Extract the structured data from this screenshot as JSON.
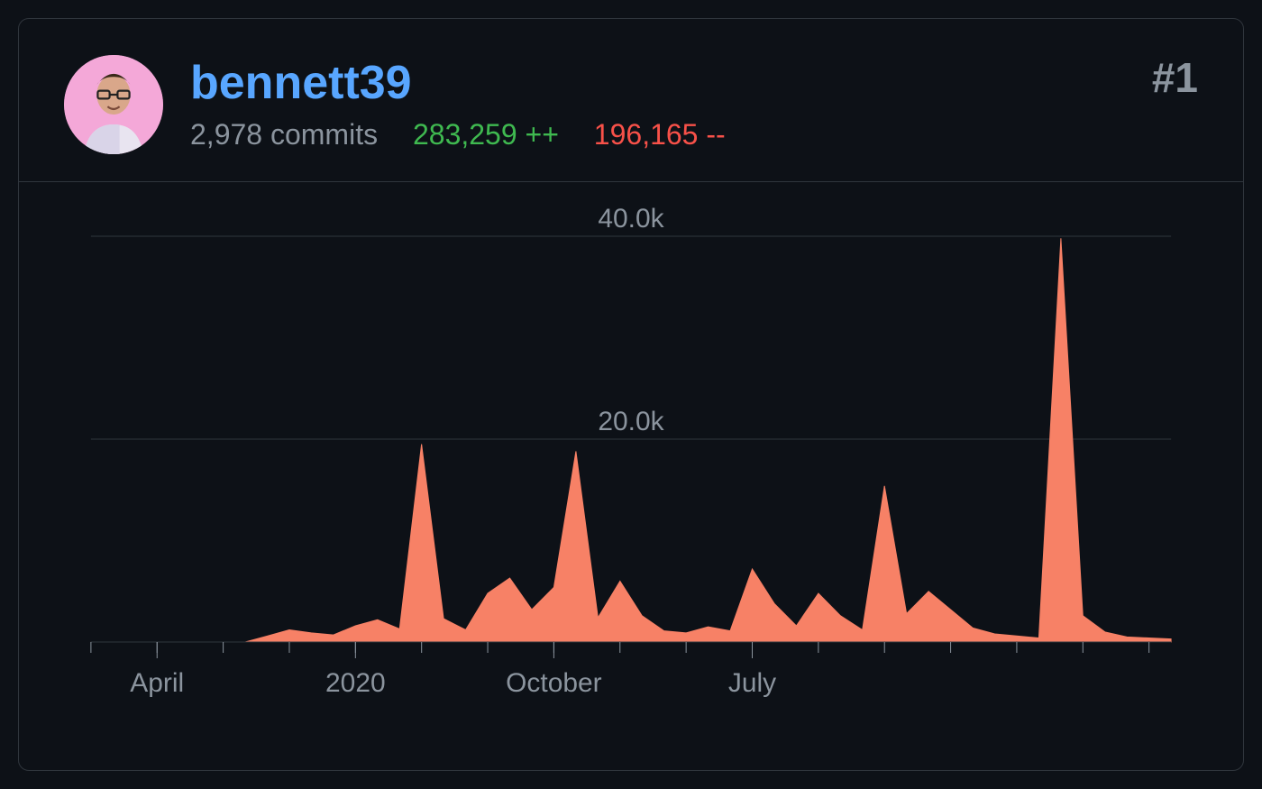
{
  "header": {
    "username": "bennett39",
    "commits_label": "2,978 commits",
    "additions_label": "283,259 ++",
    "deletions_label": "196,165 --",
    "rank_label": "#1"
  },
  "chart_data": {
    "type": "area",
    "title": "",
    "xlabel": "",
    "ylabel": "",
    "ylim": [
      0,
      40000
    ],
    "y_ticks": [
      {
        "value": 20000,
        "label": "20.0k"
      },
      {
        "value": 40000,
        "label": "40.0k"
      }
    ],
    "x_tick_labels": [
      "April",
      "2020",
      "October",
      "July"
    ],
    "x_tick_positions": [
      3,
      12,
      21,
      30
    ],
    "x_minor_tick_every": 3,
    "series": [
      {
        "name": "commits",
        "color": "#f78166",
        "values": [
          0,
          0,
          0,
          0,
          0,
          0,
          0,
          0,
          600,
          1200,
          900,
          700,
          1600,
          2200,
          1300,
          19500,
          2300,
          1200,
          4800,
          6300,
          3200,
          5400,
          18800,
          2400,
          6000,
          2600,
          1100,
          900,
          1500,
          1100,
          7200,
          3800,
          1600,
          4800,
          2600,
          1200,
          15400,
          2800,
          5000,
          3200,
          1400,
          800,
          600,
          400,
          39800,
          2600,
          1000,
          500,
          400,
          300
        ]
      }
    ]
  }
}
